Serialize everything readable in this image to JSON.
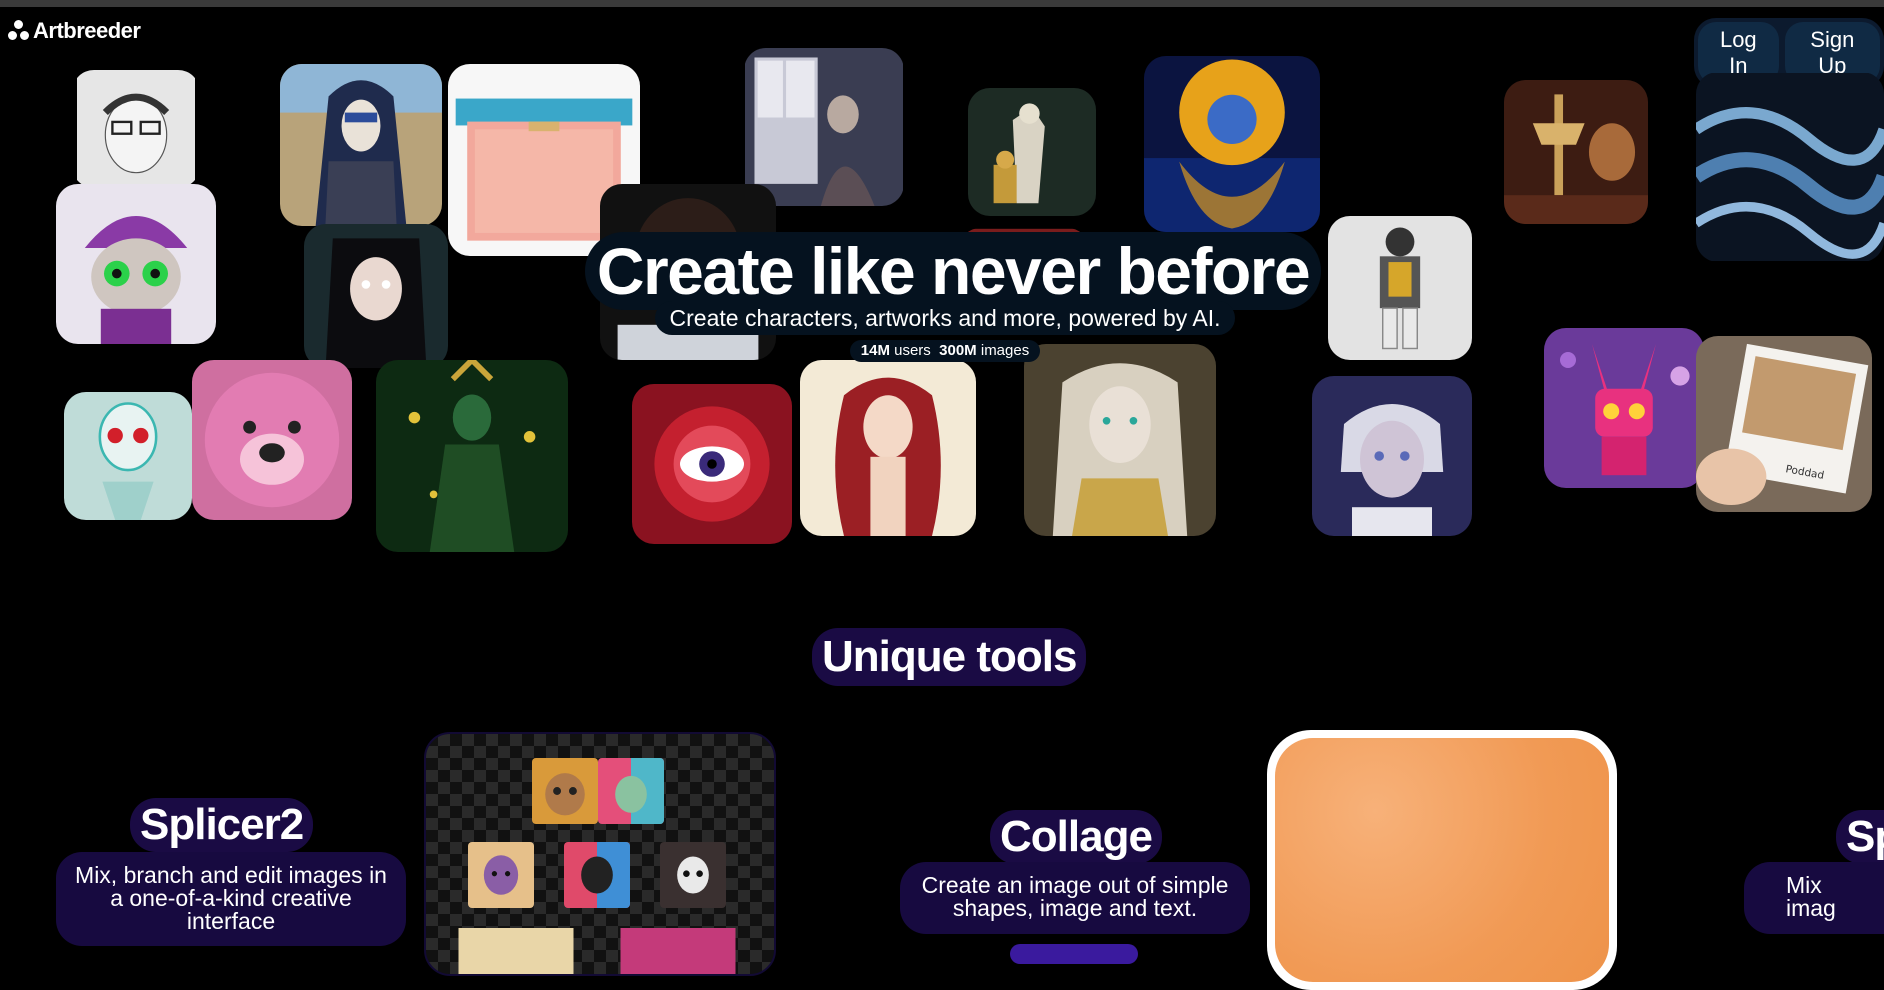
{
  "app": {
    "logo_text": "Artbreeder"
  },
  "auth": {
    "login_label": "Log In",
    "signup_label": "Sign Up"
  },
  "hero": {
    "title": "Create like never before",
    "subtitle": "Create characters, artworks and more, powered by AI.",
    "stats": {
      "users_value": "14M",
      "users_label": "users",
      "images_value": "300M",
      "images_label": "images"
    }
  },
  "tools": {
    "heading": "Unique tools",
    "items": [
      {
        "name": "Splicer2",
        "description": "Mix, branch and edit images in a one-of-a-kind creative interface"
      },
      {
        "name": "Collage",
        "description": "Create an image out of simple shapes, image and text."
      },
      {
        "name": "Sp",
        "description": "Mix imag"
      }
    ]
  },
  "gallery": {
    "tiles": [
      "sketch-man-glasses",
      "masked-woman-ruins",
      "pink-purse",
      "woman-at-window",
      "armored-figures",
      "golden-hair-woman-water",
      "lamp-fire-figure",
      "blue-silk-waves",
      "purple-hat-creature",
      "elf-girl-dark-hair",
      "dark-skin-portrait",
      "partial-tile",
      "astronaut-figure",
      "skeleton-robot",
      "pink-lion",
      "green-forest-goddess",
      "red-eye-flower",
      "red-hair-woman",
      "gold-filigree-woman",
      "white-hair-girl",
      "pink-robot-bunny",
      "hand-holding-polaroid"
    ],
    "polaroid_caption": "Poddad"
  },
  "colors": {
    "background": "#000000",
    "hero_label_bg": "#05121f",
    "tool_label_bg": "#1a0b44",
    "auth_button_bg": "#102a44",
    "collage_fill": "#f19a55"
  }
}
